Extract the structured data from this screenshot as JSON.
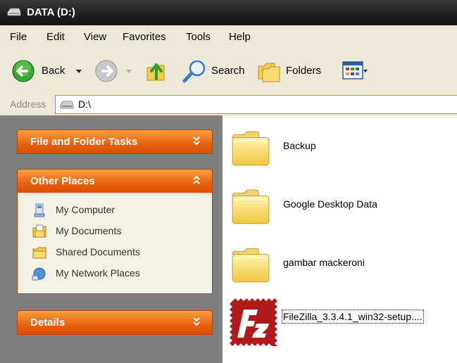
{
  "window": {
    "title": "DATA (D:)"
  },
  "menu": [
    "File",
    "Edit",
    "View",
    "Favorites",
    "Tools",
    "Help"
  ],
  "toolbar": {
    "back_label": "Back",
    "search_label": "Search",
    "folders_label": "Folders"
  },
  "address": {
    "label": "Address",
    "value": "D:\\"
  },
  "tasks": {
    "file_folder_title": "File and Folder Tasks",
    "other_places_title": "Other Places",
    "details_title": "Details",
    "places": [
      {
        "label": "My Computer",
        "icon": "my-computer-icon"
      },
      {
        "label": "My Documents",
        "icon": "my-documents-icon"
      },
      {
        "label": "Shared Documents",
        "icon": "shared-documents-icon"
      },
      {
        "label": "My Network Places",
        "icon": "network-places-icon"
      }
    ]
  },
  "files": [
    {
      "name": "Backup",
      "icon": "folder-icon"
    },
    {
      "name": "Google Desktop Data",
      "icon": "folder-icon"
    },
    {
      "name": "gambar mackeroni",
      "icon": "folder-icon"
    },
    {
      "name": "FileZilla_3.3.4.1_win32-setup....",
      "icon": "filezilla-icon"
    }
  ],
  "colors": {
    "panel_header": "#e86010",
    "panel_body": "#f4f2e4",
    "left_pane_bg": "#7f7f7f",
    "chrome": "#ece9d8",
    "titlebar": "#1e1e1e"
  }
}
